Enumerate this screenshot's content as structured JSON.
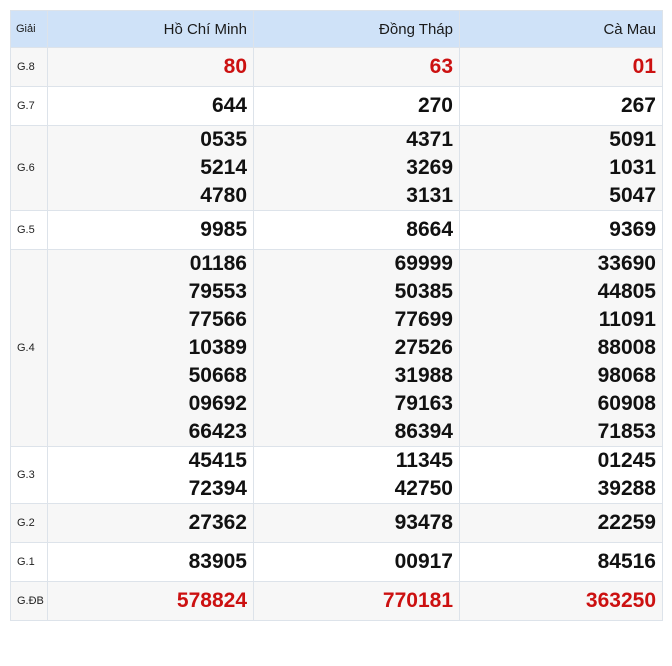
{
  "header": {
    "prize_label": "Giải",
    "provinces": [
      "Hồ Chí Minh",
      "Đồng Tháp",
      "Cà Mau"
    ]
  },
  "colors": {
    "header_bg": "#cfe2f8",
    "highlight_red": "#cc1111"
  },
  "rows": [
    {
      "prize": "G.8",
      "red": true,
      "values": [
        [
          "80"
        ],
        [
          "63"
        ],
        [
          "01"
        ]
      ]
    },
    {
      "prize": "G.7",
      "red": false,
      "values": [
        [
          "644"
        ],
        [
          "270"
        ],
        [
          "267"
        ]
      ]
    },
    {
      "prize": "G.6",
      "red": false,
      "values": [
        [
          "0535",
          "5214",
          "4780"
        ],
        [
          "4371",
          "3269",
          "3131"
        ],
        [
          "5091",
          "1031",
          "5047"
        ]
      ]
    },
    {
      "prize": "G.5",
      "red": false,
      "values": [
        [
          "9985"
        ],
        [
          "8664"
        ],
        [
          "9369"
        ]
      ]
    },
    {
      "prize": "G.4",
      "red": false,
      "values": [
        [
          "01186",
          "79553",
          "77566",
          "10389",
          "50668",
          "09692",
          "66423"
        ],
        [
          "69999",
          "50385",
          "77699",
          "27526",
          "31988",
          "79163",
          "86394"
        ],
        [
          "33690",
          "44805",
          "11091",
          "88008",
          "98068",
          "60908",
          "71853"
        ]
      ]
    },
    {
      "prize": "G.3",
      "red": false,
      "values": [
        [
          "45415",
          "72394"
        ],
        [
          "11345",
          "42750"
        ],
        [
          "01245",
          "39288"
        ]
      ]
    },
    {
      "prize": "G.2",
      "red": false,
      "values": [
        [
          "27362"
        ],
        [
          "93478"
        ],
        [
          "22259"
        ]
      ]
    },
    {
      "prize": "G.1",
      "red": false,
      "values": [
        [
          "83905"
        ],
        [
          "00917"
        ],
        [
          "84516"
        ]
      ]
    },
    {
      "prize": "G.ĐB",
      "red": true,
      "values": [
        [
          "578824"
        ],
        [
          "770181"
        ],
        [
          "363250"
        ]
      ]
    }
  ]
}
